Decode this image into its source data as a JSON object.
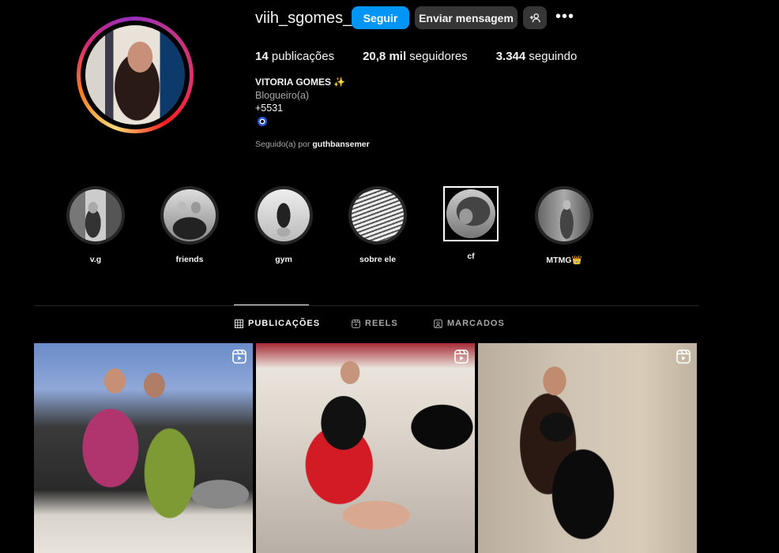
{
  "profile": {
    "username": "viih_sgomes_",
    "follow_label": "Seguir",
    "message_label": "Enviar mensagem",
    "more_label": "•••",
    "stats": {
      "posts_count": "14",
      "posts_label": "publicações",
      "followers_count": "20,8 mil",
      "followers_label": "seguidores",
      "following_count": "3.344",
      "following_label": "seguindo"
    },
    "full_name": "VITORIA GOMES ✨",
    "category": "Blogueiro(a)",
    "phone": "+5531",
    "followed_by_prefix": "Seguido(a) por",
    "followed_by_user": "guthbansemer"
  },
  "highlights": [
    {
      "label": "v.g"
    },
    {
      "label": "friends"
    },
    {
      "label": "gym"
    },
    {
      "label": "sobre ele"
    },
    {
      "label": "cf"
    },
    {
      "label": "MTMG👑"
    }
  ],
  "tabs": [
    {
      "label": "PUBLICAÇÕES",
      "icon": "grid-icon",
      "active": true
    },
    {
      "label": "REELS",
      "icon": "reels-icon",
      "active": false
    },
    {
      "label": "MARCADOS",
      "icon": "tagged-icon",
      "active": false
    }
  ],
  "posts": [
    {
      "type": "reel"
    },
    {
      "type": "reel"
    },
    {
      "type": "reel"
    }
  ],
  "colors": {
    "accent": "#0095f6",
    "background": "#000000",
    "secondary_button": "#363636"
  }
}
